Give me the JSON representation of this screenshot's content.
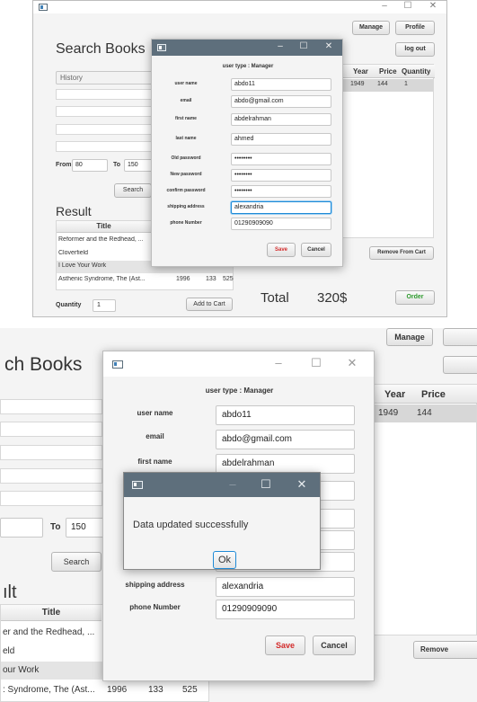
{
  "window_controls": {
    "minimize": "–",
    "maximize": "☐",
    "close": "✕"
  },
  "main": {
    "page_title": "Search Books",
    "manage_label": "Manage",
    "profile_label": "Profile",
    "logout_label": "log out",
    "search_field_value": "History",
    "from_label": "From",
    "from_value": "80",
    "to_label": "To",
    "to_value": "150",
    "search_label": "Search",
    "result_label": "Result",
    "result_header": "Title",
    "result_rows": [
      {
        "title": "Reformer and the Redhead, ...",
        "year": "",
        "price": "",
        "qty": ""
      },
      {
        "title": "Cloverfield",
        "year": "",
        "price": "",
        "qty": ""
      },
      {
        "title": "I Love Your Work",
        "year": "",
        "price": "",
        "qty": ""
      },
      {
        "title": "Asthenic Syndrome, The (Ast...",
        "year": "1996",
        "price": "133",
        "qty": "525"
      }
    ],
    "quantity_label": "Quantity",
    "quantity_value": "1",
    "add_to_cart_label": "Add to Cart",
    "cart_headers": {
      "year": "Year",
      "price": "Price",
      "quantity": "Quantity"
    },
    "cart_row": {
      "year": "1949",
      "price": "144",
      "quantity": "1"
    },
    "remove_from_cart_label": "Remove From Cart",
    "total_label": "Total",
    "total_value": "320$",
    "order_label": "Order"
  },
  "dialog": {
    "user_type": "user type : Manager",
    "fields": [
      {
        "label": "user name",
        "value": "abdo11"
      },
      {
        "label": "email",
        "value": "abdo@gmail.com"
      },
      {
        "label": "first name",
        "value": "abdelrahman"
      },
      {
        "label": "last name",
        "value": "ahmed"
      },
      {
        "label": "Old password",
        "value": "••••••••"
      },
      {
        "label": "New password",
        "value": "••••••••"
      },
      {
        "label": "confirm password",
        "value": "••••••••"
      },
      {
        "label": "shipping address",
        "value": "alexandria"
      },
      {
        "label": "phone Number",
        "value": "01290909090"
      }
    ],
    "save_label": "Save",
    "cancel_label": "Cancel"
  },
  "zoom": {
    "page_title_fragment": "ch Books",
    "manage_label": "Manage",
    "to_label": "To",
    "to_value": "150",
    "search_label": "Search",
    "result_fragment": "ılt",
    "result_header": "Title",
    "result_rows": [
      "er and the Redhead, ...",
      "eld",
      "our Work"
    ],
    "last_row": {
      "title": ": Syndrome, The (Ast...",
      "year": "1996",
      "price": "133",
      "qty": "525"
    },
    "cart_headers": {
      "year": "Year",
      "price": "Price"
    },
    "cart_row": {
      "year": "1949",
      "price": "144"
    },
    "remove_fragment": "Remove",
    "user_type": "user type : Manager",
    "fields": [
      {
        "label": "user name",
        "value": "abdo11"
      },
      {
        "label": "email",
        "value": "abdo@gmail.com"
      },
      {
        "label": "first name",
        "value": "abdelrahman"
      }
    ],
    "fields_bottom": [
      {
        "label": "shipping address",
        "value": "alexandria"
      },
      {
        "label": "phone Number",
        "value": "01290909090"
      }
    ],
    "save_label": "Save",
    "cancel_label": "Cancel",
    "alert_message": "Data updated successfully",
    "ok_label": "Ok"
  }
}
